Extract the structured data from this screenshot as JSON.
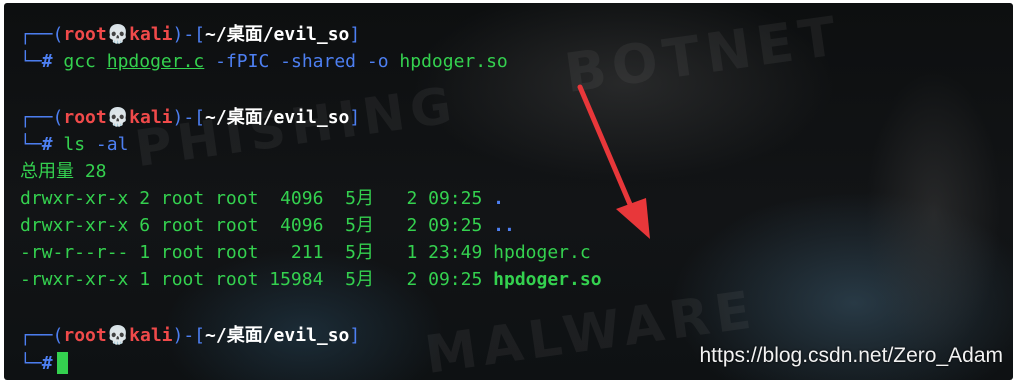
{
  "prompt": {
    "corner_top": "┌──",
    "corner_bottom": "└─",
    "user": "root",
    "skull": "💀",
    "host": "kali",
    "path": "~/桌面/evil_so",
    "hash": "#"
  },
  "block1": {
    "cmd": "gcc",
    "file": "hpdoger.c",
    "flag1": "-fPIC",
    "flag2": "-shared",
    "flag3": "-o",
    "out": "hpdoger.so"
  },
  "block2": {
    "cmd": "ls",
    "flag": "-al",
    "total": "总用量 28",
    "rows": [
      {
        "meta": "drwxr-xr-x 2 root root  4096  5月   2 09:25 ",
        "name": "."
      },
      {
        "meta": "drwxr-xr-x 6 root root  4096  5月   2 09:25 ",
        "name": ".."
      },
      {
        "meta": "-rw-r--r-- 1 root root   211  5月   1 23:49 ",
        "name": "hpdoger.c"
      },
      {
        "meta": "-rwxr-xr-x 1 root root 15984  5月   2 09:25 ",
        "name": "hpdoger.so"
      }
    ]
  },
  "watermark": "https://blog.csdn.net/Zero_Adam",
  "colors": {
    "green": "#34d14f",
    "blue": "#4d7ff2",
    "red": "#f04a4a",
    "arrow": "#e8373a"
  }
}
